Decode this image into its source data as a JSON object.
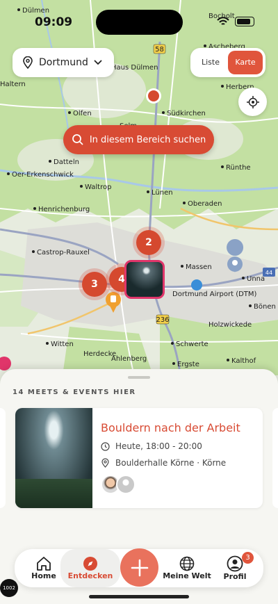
{
  "status_bar": {
    "time": "09:09"
  },
  "map": {
    "place_labels": [
      "Dülmen",
      "Bocholt",
      "Ascheberg",
      "Herbern",
      "Olfen",
      "Selm",
      "Südkirchen",
      "Datteln",
      "Oer-Erkenschwick",
      "Waltrop",
      "Lünen",
      "Henrichenburg",
      "Castrop-Rauxel",
      "Massen",
      "Dortmund Airport (DTM)",
      "Unna",
      "Witten",
      "Schwerte",
      "Holzwickede",
      "Herdecke",
      "Ahlenberg",
      "Ergste",
      "Kalthof",
      "Oberaden",
      "Rünthe",
      "Bönen",
      "Haltern",
      "Haus Dülmen"
    ],
    "road_labels": [
      "58",
      "236",
      "44"
    ],
    "clusters": [
      "2",
      "3",
      "4"
    ]
  },
  "header": {
    "city": "Dortmund",
    "view_options": [
      "Liste",
      "Karte"
    ],
    "active_view": "Karte"
  },
  "search_area_label": "In diesem Bereich suchen",
  "sheet": {
    "title": "14 MEETS & EVENTS HIER",
    "card": {
      "title": "Bouldern nach der Arbeit",
      "time": "Heute, 18:00 - 20:00",
      "location": "Boulderhalle Körne · Körne"
    }
  },
  "nav": {
    "items": [
      "Home",
      "Entdecken",
      "Meine Welt",
      "Profil"
    ],
    "active": "Entdecken",
    "profile_badge": "3"
  },
  "debug_badge": "1002",
  "colors": {
    "accent": "#d84b34",
    "map_green": "#c5e3a4",
    "map_bg": "#e9efe2",
    "motorway": "#9aa4c2"
  }
}
